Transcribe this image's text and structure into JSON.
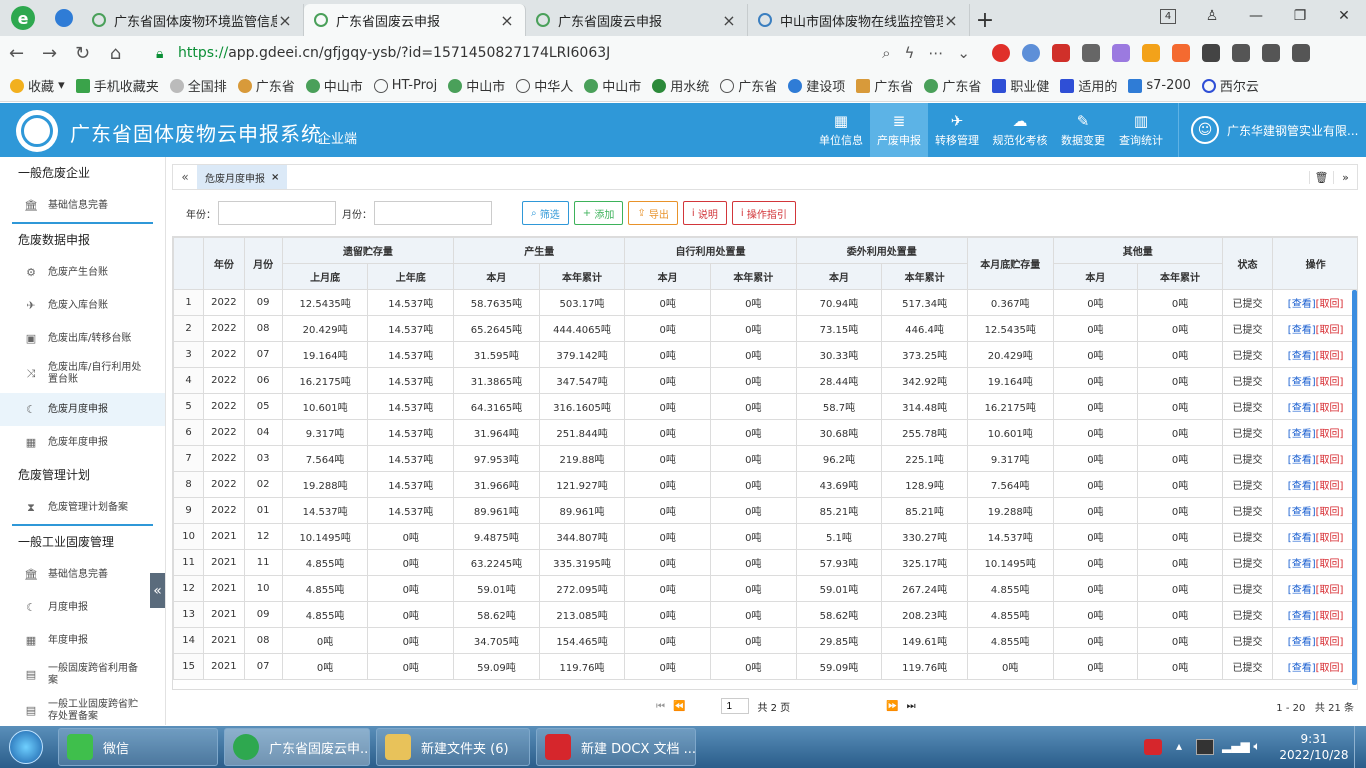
{
  "browser": {
    "tabs": [
      {
        "title": "广东省固体废物环境监管信息"
      },
      {
        "title": "广东省固废云申报"
      },
      {
        "title": "广东省固废云申报"
      },
      {
        "title": "中山市固体废物在线监控管理"
      }
    ],
    "tab_count": "4",
    "url_https": "https://",
    "url_rest": "app.gdeei.cn/gfjgqy-ysb/?id=1571450827174LRI6063J"
  },
  "bookmarks": [
    "收藏",
    "手机收藏夹",
    "全国排",
    "广东省",
    "中山市",
    "HT-Proj",
    "中山市",
    "中华人",
    "中山市",
    "用水统",
    "广东省",
    "建设项",
    "广东省",
    "广东省",
    "职业健",
    "适用的",
    "s7-200",
    "西尔云"
  ],
  "app": {
    "title": "广东省固体废物云申报系统",
    "subtitle": "企业端",
    "nav": [
      {
        "label": "单位信息",
        "icon": "building-icon"
      },
      {
        "label": "产废申报",
        "icon": "database-icon"
      },
      {
        "label": "转移管理",
        "icon": "plane-icon"
      },
      {
        "label": "规范化考核",
        "icon": "cloud-icon"
      },
      {
        "label": "数据变更",
        "icon": "edit-icon"
      },
      {
        "label": "查询统计",
        "icon": "chart-icon"
      }
    ],
    "user": "广东华建钢管实业有限..."
  },
  "sidebar": {
    "groups": [
      {
        "title": "一般危废企业",
        "items": [
          {
            "label": "基础信息完善",
            "icon": "bank-icon"
          }
        ]
      },
      {
        "title": "危废数据申报",
        "items": [
          {
            "label": "危废产生台账",
            "icon": "cogs-icon"
          },
          {
            "label": "危废入库台账",
            "icon": "plane-icon"
          },
          {
            "label": "危废出库/转移台账",
            "icon": "box-icon"
          },
          {
            "label": "危废出库/自行利用处置台账",
            "icon": "shuffle-icon"
          },
          {
            "label": "危废月度申报",
            "icon": "moon-icon"
          },
          {
            "label": "危废年度申报",
            "icon": "calendar-icon"
          }
        ]
      },
      {
        "title": "危废管理计划",
        "items": [
          {
            "label": "危废管理计划备案",
            "icon": "hourglass-icon"
          }
        ]
      },
      {
        "title": "一般工业固废管理",
        "items": [
          {
            "label": "基础信息完善",
            "icon": "bank-icon"
          },
          {
            "label": "月度申报",
            "icon": "moon-icon"
          },
          {
            "label": "年度申报",
            "icon": "calendar-icon"
          },
          {
            "label": "一般固废跨省利用备案",
            "icon": "calendar-check-icon"
          },
          {
            "label": "一般工业固废跨省贮存处置备案",
            "icon": "calendar-check-icon"
          }
        ]
      }
    ]
  },
  "content": {
    "tab_label": "危废月度申报",
    "filter": {
      "year_label": "年份：",
      "month_label": "月份：",
      "year_value": "",
      "month_value": "",
      "buttons": [
        {
          "label": "筛选",
          "icon": "search-icon",
          "style": "blue"
        },
        {
          "label": "添加",
          "icon": "plus-icon",
          "style": "green"
        },
        {
          "label": "导出",
          "icon": "upload-icon",
          "style": "orange"
        },
        {
          "label": "说明",
          "icon": "info-icon",
          "style": "red"
        },
        {
          "label": "操作指引",
          "icon": "info-icon",
          "style": "red"
        }
      ]
    },
    "table": {
      "headers": {
        "year": "年份",
        "month": "月份",
        "carry": "遗留贮存量",
        "produce": "产生量",
        "self": "自行利用处置量",
        "outside": "委外利用处置量",
        "end_stock": "本月底贮存量",
        "other": "其他量",
        "status": "状态",
        "ops": "操作",
        "last_month_end": "上月底",
        "last_year_end": "上年底",
        "this_month": "本月",
        "year_total": "本年累计"
      },
      "rows": [
        [
          "1",
          "2022",
          "09",
          "12.5435吨",
          "14.537吨",
          "58.7635吨",
          "503.17吨",
          "0吨",
          "0吨",
          "70.94吨",
          "517.34吨",
          "0.367吨",
          "0吨",
          "0吨",
          "已提交"
        ],
        [
          "2",
          "2022",
          "08",
          "20.429吨",
          "14.537吨",
          "65.2645吨",
          "444.4065吨",
          "0吨",
          "0吨",
          "73.15吨",
          "446.4吨",
          "12.5435吨",
          "0吨",
          "0吨",
          "已提交"
        ],
        [
          "3",
          "2022",
          "07",
          "19.164吨",
          "14.537吨",
          "31.595吨",
          "379.142吨",
          "0吨",
          "0吨",
          "30.33吨",
          "373.25吨",
          "20.429吨",
          "0吨",
          "0吨",
          "已提交"
        ],
        [
          "4",
          "2022",
          "06",
          "16.2175吨",
          "14.537吨",
          "31.3865吨",
          "347.547吨",
          "0吨",
          "0吨",
          "28.44吨",
          "342.92吨",
          "19.164吨",
          "0吨",
          "0吨",
          "已提交"
        ],
        [
          "5",
          "2022",
          "05",
          "10.601吨",
          "14.537吨",
          "64.3165吨",
          "316.1605吨",
          "0吨",
          "0吨",
          "58.7吨",
          "314.48吨",
          "16.2175吨",
          "0吨",
          "0吨",
          "已提交"
        ],
        [
          "6",
          "2022",
          "04",
          "9.317吨",
          "14.537吨",
          "31.964吨",
          "251.844吨",
          "0吨",
          "0吨",
          "30.68吨",
          "255.78吨",
          "10.601吨",
          "0吨",
          "0吨",
          "已提交"
        ],
        [
          "7",
          "2022",
          "03",
          "7.564吨",
          "14.537吨",
          "97.953吨",
          "219.88吨",
          "0吨",
          "0吨",
          "96.2吨",
          "225.1吨",
          "9.317吨",
          "0吨",
          "0吨",
          "已提交"
        ],
        [
          "8",
          "2022",
          "02",
          "19.288吨",
          "14.537吨",
          "31.966吨",
          "121.927吨",
          "0吨",
          "0吨",
          "43.69吨",
          "128.9吨",
          "7.564吨",
          "0吨",
          "0吨",
          "已提交"
        ],
        [
          "9",
          "2022",
          "01",
          "14.537吨",
          "14.537吨",
          "89.961吨",
          "89.961吨",
          "0吨",
          "0吨",
          "85.21吨",
          "85.21吨",
          "19.288吨",
          "0吨",
          "0吨",
          "已提交"
        ],
        [
          "10",
          "2021",
          "12",
          "10.1495吨",
          "0吨",
          "9.4875吨",
          "344.807吨",
          "0吨",
          "0吨",
          "5.1吨",
          "330.27吨",
          "14.537吨",
          "0吨",
          "0吨",
          "已提交"
        ],
        [
          "11",
          "2021",
          "11",
          "4.855吨",
          "0吨",
          "63.2245吨",
          "335.3195吨",
          "0吨",
          "0吨",
          "57.93吨",
          "325.17吨",
          "10.1495吨",
          "0吨",
          "0吨",
          "已提交"
        ],
        [
          "12",
          "2021",
          "10",
          "4.855吨",
          "0吨",
          "59.01吨",
          "272.095吨",
          "0吨",
          "0吨",
          "59.01吨",
          "267.24吨",
          "4.855吨",
          "0吨",
          "0吨",
          "已提交"
        ],
        [
          "13",
          "2021",
          "09",
          "4.855吨",
          "0吨",
          "58.62吨",
          "213.085吨",
          "0吨",
          "0吨",
          "58.62吨",
          "208.23吨",
          "4.855吨",
          "0吨",
          "0吨",
          "已提交"
        ],
        [
          "14",
          "2021",
          "08",
          "0吨",
          "0吨",
          "34.705吨",
          "154.465吨",
          "0吨",
          "0吨",
          "29.85吨",
          "149.61吨",
          "4.855吨",
          "0吨",
          "0吨",
          "已提交"
        ],
        [
          "15",
          "2021",
          "07",
          "0吨",
          "0吨",
          "59.09吨",
          "119.76吨",
          "0吨",
          "0吨",
          "59.09吨",
          "119.76吨",
          "0吨",
          "0吨",
          "0吨",
          "已提交"
        ]
      ],
      "view_label": "[查看]",
      "withdraw_label": "[取回]"
    },
    "pager": {
      "page": "1",
      "total_pages": "共 2 页",
      "range": "1 - 20",
      "total": "共 21 条"
    }
  },
  "taskbar": {
    "items": [
      {
        "label": "微信"
      },
      {
        "label": "广东省固废云申..."
      },
      {
        "label": "新建文件夹 (6)"
      },
      {
        "label": "新建 DOCX 文档 ..."
      }
    ],
    "time": "9:31",
    "date": "2022/10/28"
  }
}
